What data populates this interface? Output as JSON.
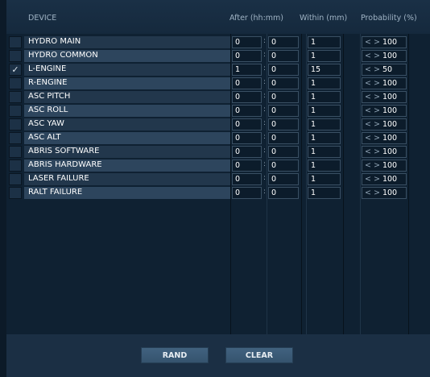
{
  "header": {
    "device": "DEVICE",
    "after": "After (hh:mm)",
    "within": "Within (mm)",
    "probability": "Probability (%)"
  },
  "rows": [
    {
      "name": "HYDRO MAIN",
      "checked": false,
      "hh": "0",
      "mm": "0",
      "within": "1",
      "prob": "100"
    },
    {
      "name": "HYDRO COMMON",
      "checked": false,
      "hh": "0",
      "mm": "0",
      "within": "1",
      "prob": "100"
    },
    {
      "name": "L-ENGINE",
      "checked": true,
      "hh": "1",
      "mm": "0",
      "within": "15",
      "prob": "50"
    },
    {
      "name": "R-ENGINE",
      "checked": false,
      "hh": "0",
      "mm": "0",
      "within": "1",
      "prob": "100"
    },
    {
      "name": "ASC PITCH",
      "checked": false,
      "hh": "0",
      "mm": "0",
      "within": "1",
      "prob": "100"
    },
    {
      "name": "ASC ROLL",
      "checked": false,
      "hh": "0",
      "mm": "0",
      "within": "1",
      "prob": "100"
    },
    {
      "name": "ASC YAW",
      "checked": false,
      "hh": "0",
      "mm": "0",
      "within": "1",
      "prob": "100"
    },
    {
      "name": "ASC ALT",
      "checked": false,
      "hh": "0",
      "mm": "0",
      "within": "1",
      "prob": "100"
    },
    {
      "name": "ABRIS SOFTWARE",
      "checked": false,
      "hh": "0",
      "mm": "0",
      "within": "1",
      "prob": "100"
    },
    {
      "name": "ABRIS HARDWARE",
      "checked": false,
      "hh": "0",
      "mm": "0",
      "within": "1",
      "prob": "100"
    },
    {
      "name": "LASER FAILURE",
      "checked": false,
      "hh": "0",
      "mm": "0",
      "within": "1",
      "prob": "100"
    },
    {
      "name": "RALT FAILURE",
      "checked": false,
      "hh": "0",
      "mm": "0",
      "within": "1",
      "prob": "100"
    }
  ],
  "symbols": {
    "colon": ":",
    "arrows": "< >",
    "check": "✓"
  },
  "buttons": {
    "rand": "RAND",
    "clear": "CLEAR"
  }
}
